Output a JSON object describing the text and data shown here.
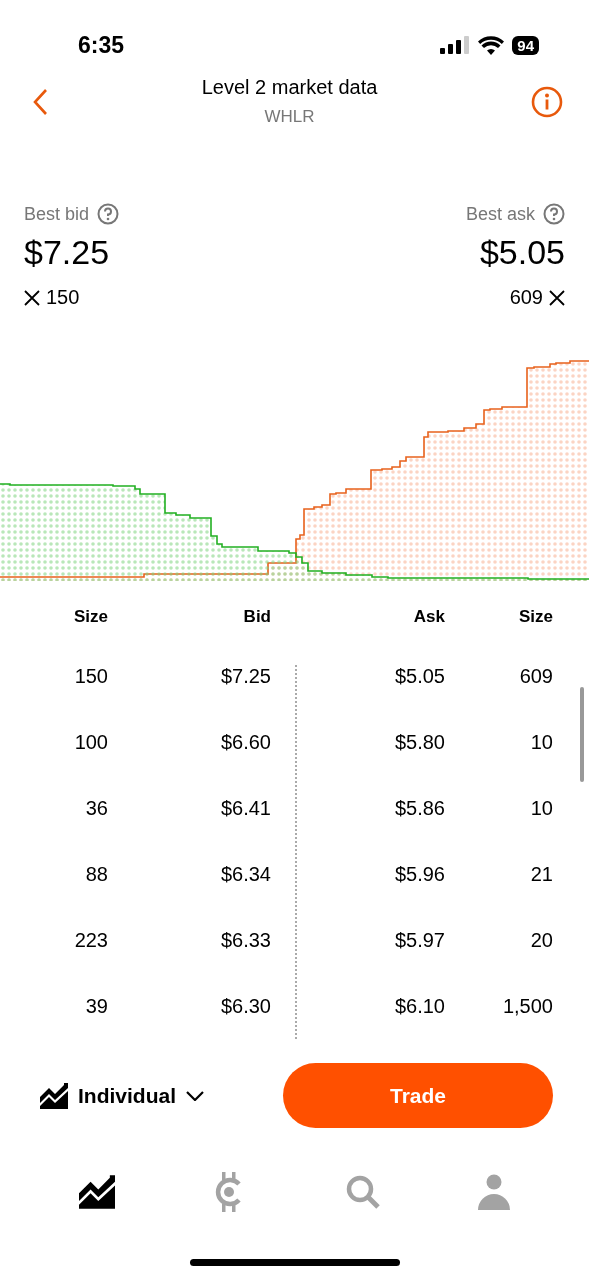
{
  "status_bar": {
    "time": "6:35",
    "battery": "94"
  },
  "header": {
    "title": "Level 2 market data",
    "subtitle": "WHLR"
  },
  "best_bid": {
    "label": "Best bid",
    "price": "$7.25",
    "size": "150"
  },
  "best_ask": {
    "label": "Best ask",
    "price": "$5.05",
    "size": "609"
  },
  "table": {
    "columns": [
      "Size",
      "Bid",
      "Ask",
      "Size"
    ],
    "rows": [
      {
        "bid_size": "150",
        "bid": "$7.25",
        "ask": "$5.05",
        "ask_size": "609"
      },
      {
        "bid_size": "100",
        "bid": "$6.60",
        "ask": "$5.80",
        "ask_size": "10"
      },
      {
        "bid_size": "36",
        "bid": "$6.41",
        "ask": "$5.86",
        "ask_size": "10"
      },
      {
        "bid_size": "88",
        "bid": "$6.34",
        "ask": "$5.96",
        "ask_size": "21"
      },
      {
        "bid_size": "223",
        "bid": "$6.33",
        "ask": "$5.97",
        "ask_size": "20"
      },
      {
        "bid_size": "39",
        "bid": "$6.30",
        "ask": "$6.10",
        "ask_size": "1,500"
      }
    ]
  },
  "account": {
    "label": "Individual"
  },
  "trade_button": "Trade",
  "tabs": [
    {
      "kind": "portfolio",
      "selected": true
    },
    {
      "kind": "crypto",
      "selected": false
    },
    {
      "kind": "search",
      "selected": false
    },
    {
      "kind": "account",
      "selected": false
    }
  ]
}
